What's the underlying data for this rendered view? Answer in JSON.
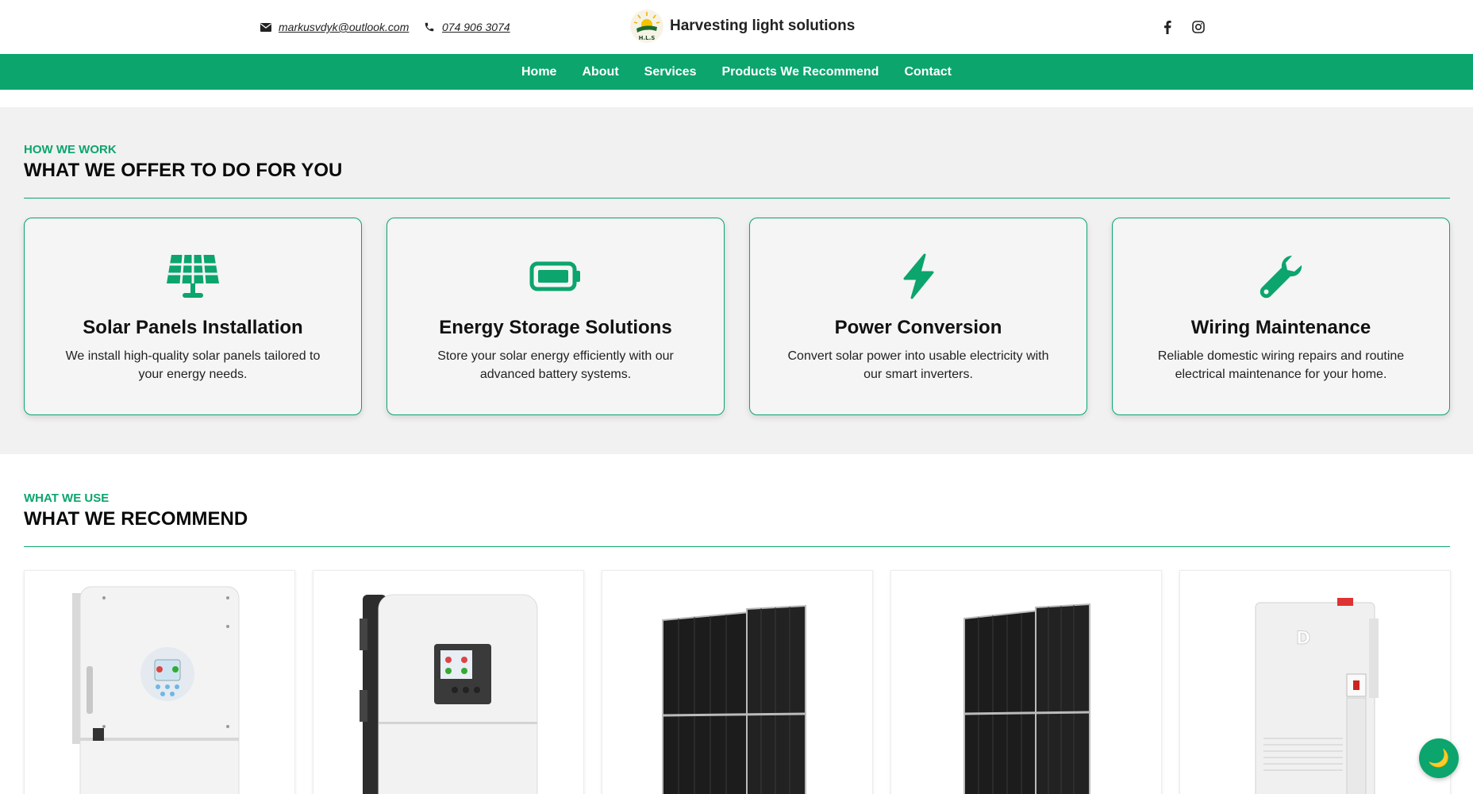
{
  "header": {
    "email": "markusvdyk@outlook.com",
    "phone": "074 906 3074",
    "brand_name": "Harvesting light solutions",
    "logo_text": "H.L.S"
  },
  "nav": {
    "items": [
      "Home",
      "About",
      "Services",
      "Products We Recommend",
      "Contact"
    ]
  },
  "offer": {
    "eyebrow": "HOW WE WORK",
    "heading": "WHAT WE OFFER TO DO FOR YOU",
    "cards": [
      {
        "icon": "solar-panel-icon",
        "title": "Solar Panels Installation",
        "text": "We install high-quality solar panels tailored to your energy needs."
      },
      {
        "icon": "battery-icon",
        "title": "Energy Storage Solutions",
        "text": "Store your solar energy efficiently with our advanced battery systems."
      },
      {
        "icon": "lightning-bolt-icon",
        "title": "Power Conversion",
        "text": "Convert solar power into usable electricity with our smart inverters."
      },
      {
        "icon": "wrench-icon",
        "title": "Wiring Maintenance",
        "text": "Reliable domestic wiring repairs and routine electrical maintenance for your home."
      }
    ]
  },
  "recommend": {
    "eyebrow": "WHAT WE USE",
    "heading": "WHAT WE RECOMMEND",
    "product_images": [
      "hybrid-inverter-image",
      "hybrid-inverter-image",
      "solar-panel-image",
      "solar-panel-image",
      "battery-storage-image"
    ]
  },
  "theme": {
    "accent": "#0ba56d",
    "section_bg": "#f1f1f1",
    "toggle_icon": "moon-icon"
  }
}
